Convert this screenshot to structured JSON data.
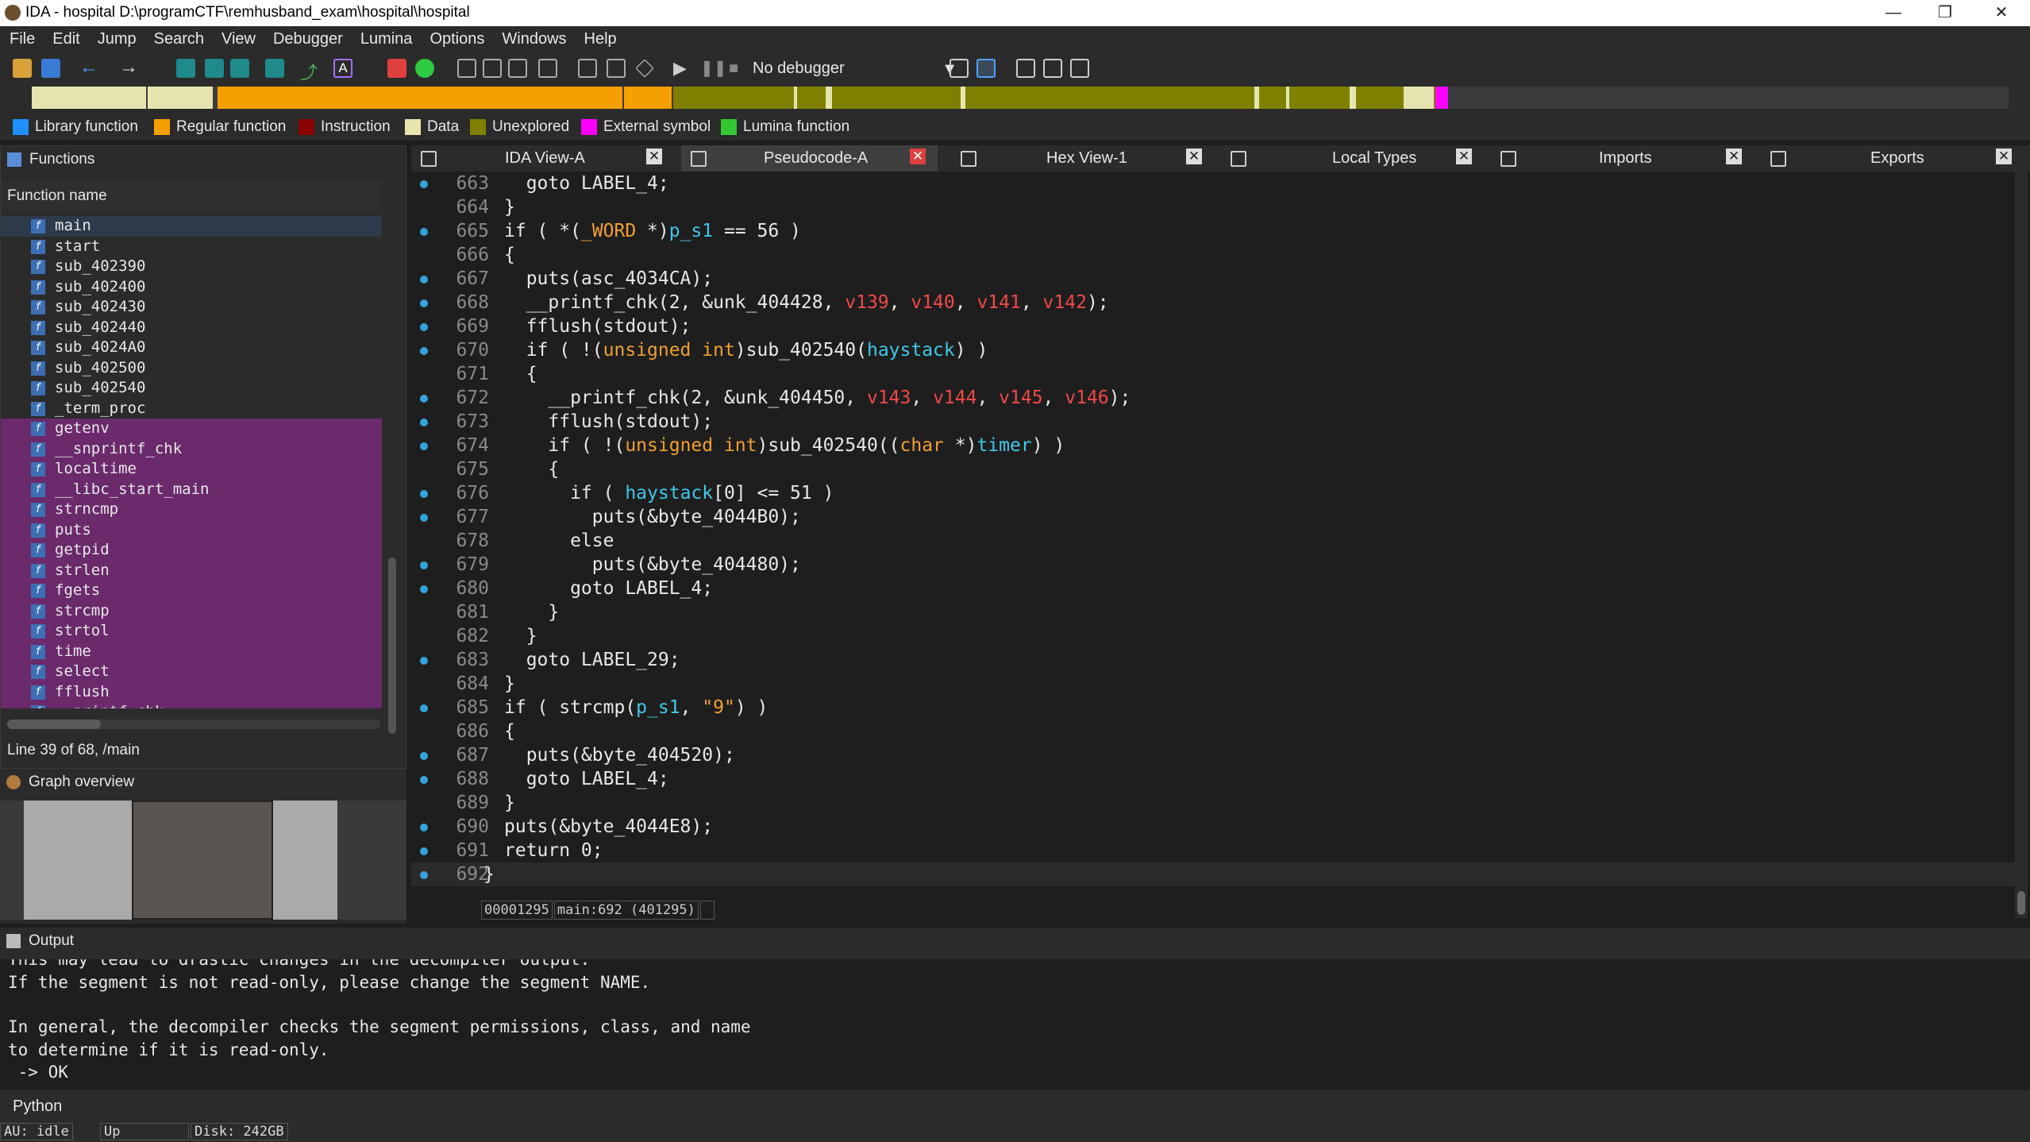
{
  "window": {
    "title": "IDA - hospital D:\\programCTF\\remhusband_exam\\hospital\\hospital"
  },
  "menu": [
    "File",
    "Edit",
    "Jump",
    "Search",
    "View",
    "Debugger",
    "Lumina",
    "Options",
    "Windows",
    "Help"
  ],
  "toolbar": {
    "debugger": "No debugger"
  },
  "legend": [
    {
      "label": "Library function",
      "color": "#1e90ff"
    },
    {
      "label": "Regular function",
      "color": "#f5a000"
    },
    {
      "label": "Instruction",
      "color": "#8b0000"
    },
    {
      "label": "Data",
      "color": "#e8e4b0"
    },
    {
      "label": "Unexplored",
      "color": "#808000"
    },
    {
      "label": "External symbol",
      "color": "#ff00ff"
    },
    {
      "label": "Lumina function",
      "color": "#32c832"
    }
  ],
  "functions": {
    "title": "Functions",
    "column": "Function name",
    "items": [
      "main",
      "start",
      "sub_402390",
      "sub_402400",
      "sub_402430",
      "sub_402440",
      "sub_4024A0",
      "sub_402500",
      "sub_402540",
      "_term_proc",
      "getenv",
      "__snprintf_chk",
      "localtime",
      "__libc_start_main",
      "strncmp",
      "puts",
      "getpid",
      "strlen",
      "fgets",
      "strcmp",
      "strtol",
      "time",
      "select",
      "fflush",
      "__printf_chk"
    ],
    "status": "Line 39 of 68, /main"
  },
  "graph": {
    "title": "Graph overview"
  },
  "tabs": [
    "IDA View-A",
    "Pseudocode-A",
    "Hex View-1",
    "Local Types",
    "Imports",
    "Exports"
  ],
  "code_status": {
    "addr": "00001295",
    "loc": "main:692 (401295)"
  },
  "output": {
    "title": "Output",
    "lines": [
      "This may lead to drastic changes in the decompiler output.",
      "If the segment is not read-only, please change the segment NAME.",
      "",
      "In general, the decompiler checks the segment permissions, class, and name",
      "to determine if it is read-only.",
      " -> OK"
    ]
  },
  "python": "Python",
  "status": {
    "au": "AU:  idle",
    "dir": "Up",
    "disk": "Disk: 242GB"
  }
}
